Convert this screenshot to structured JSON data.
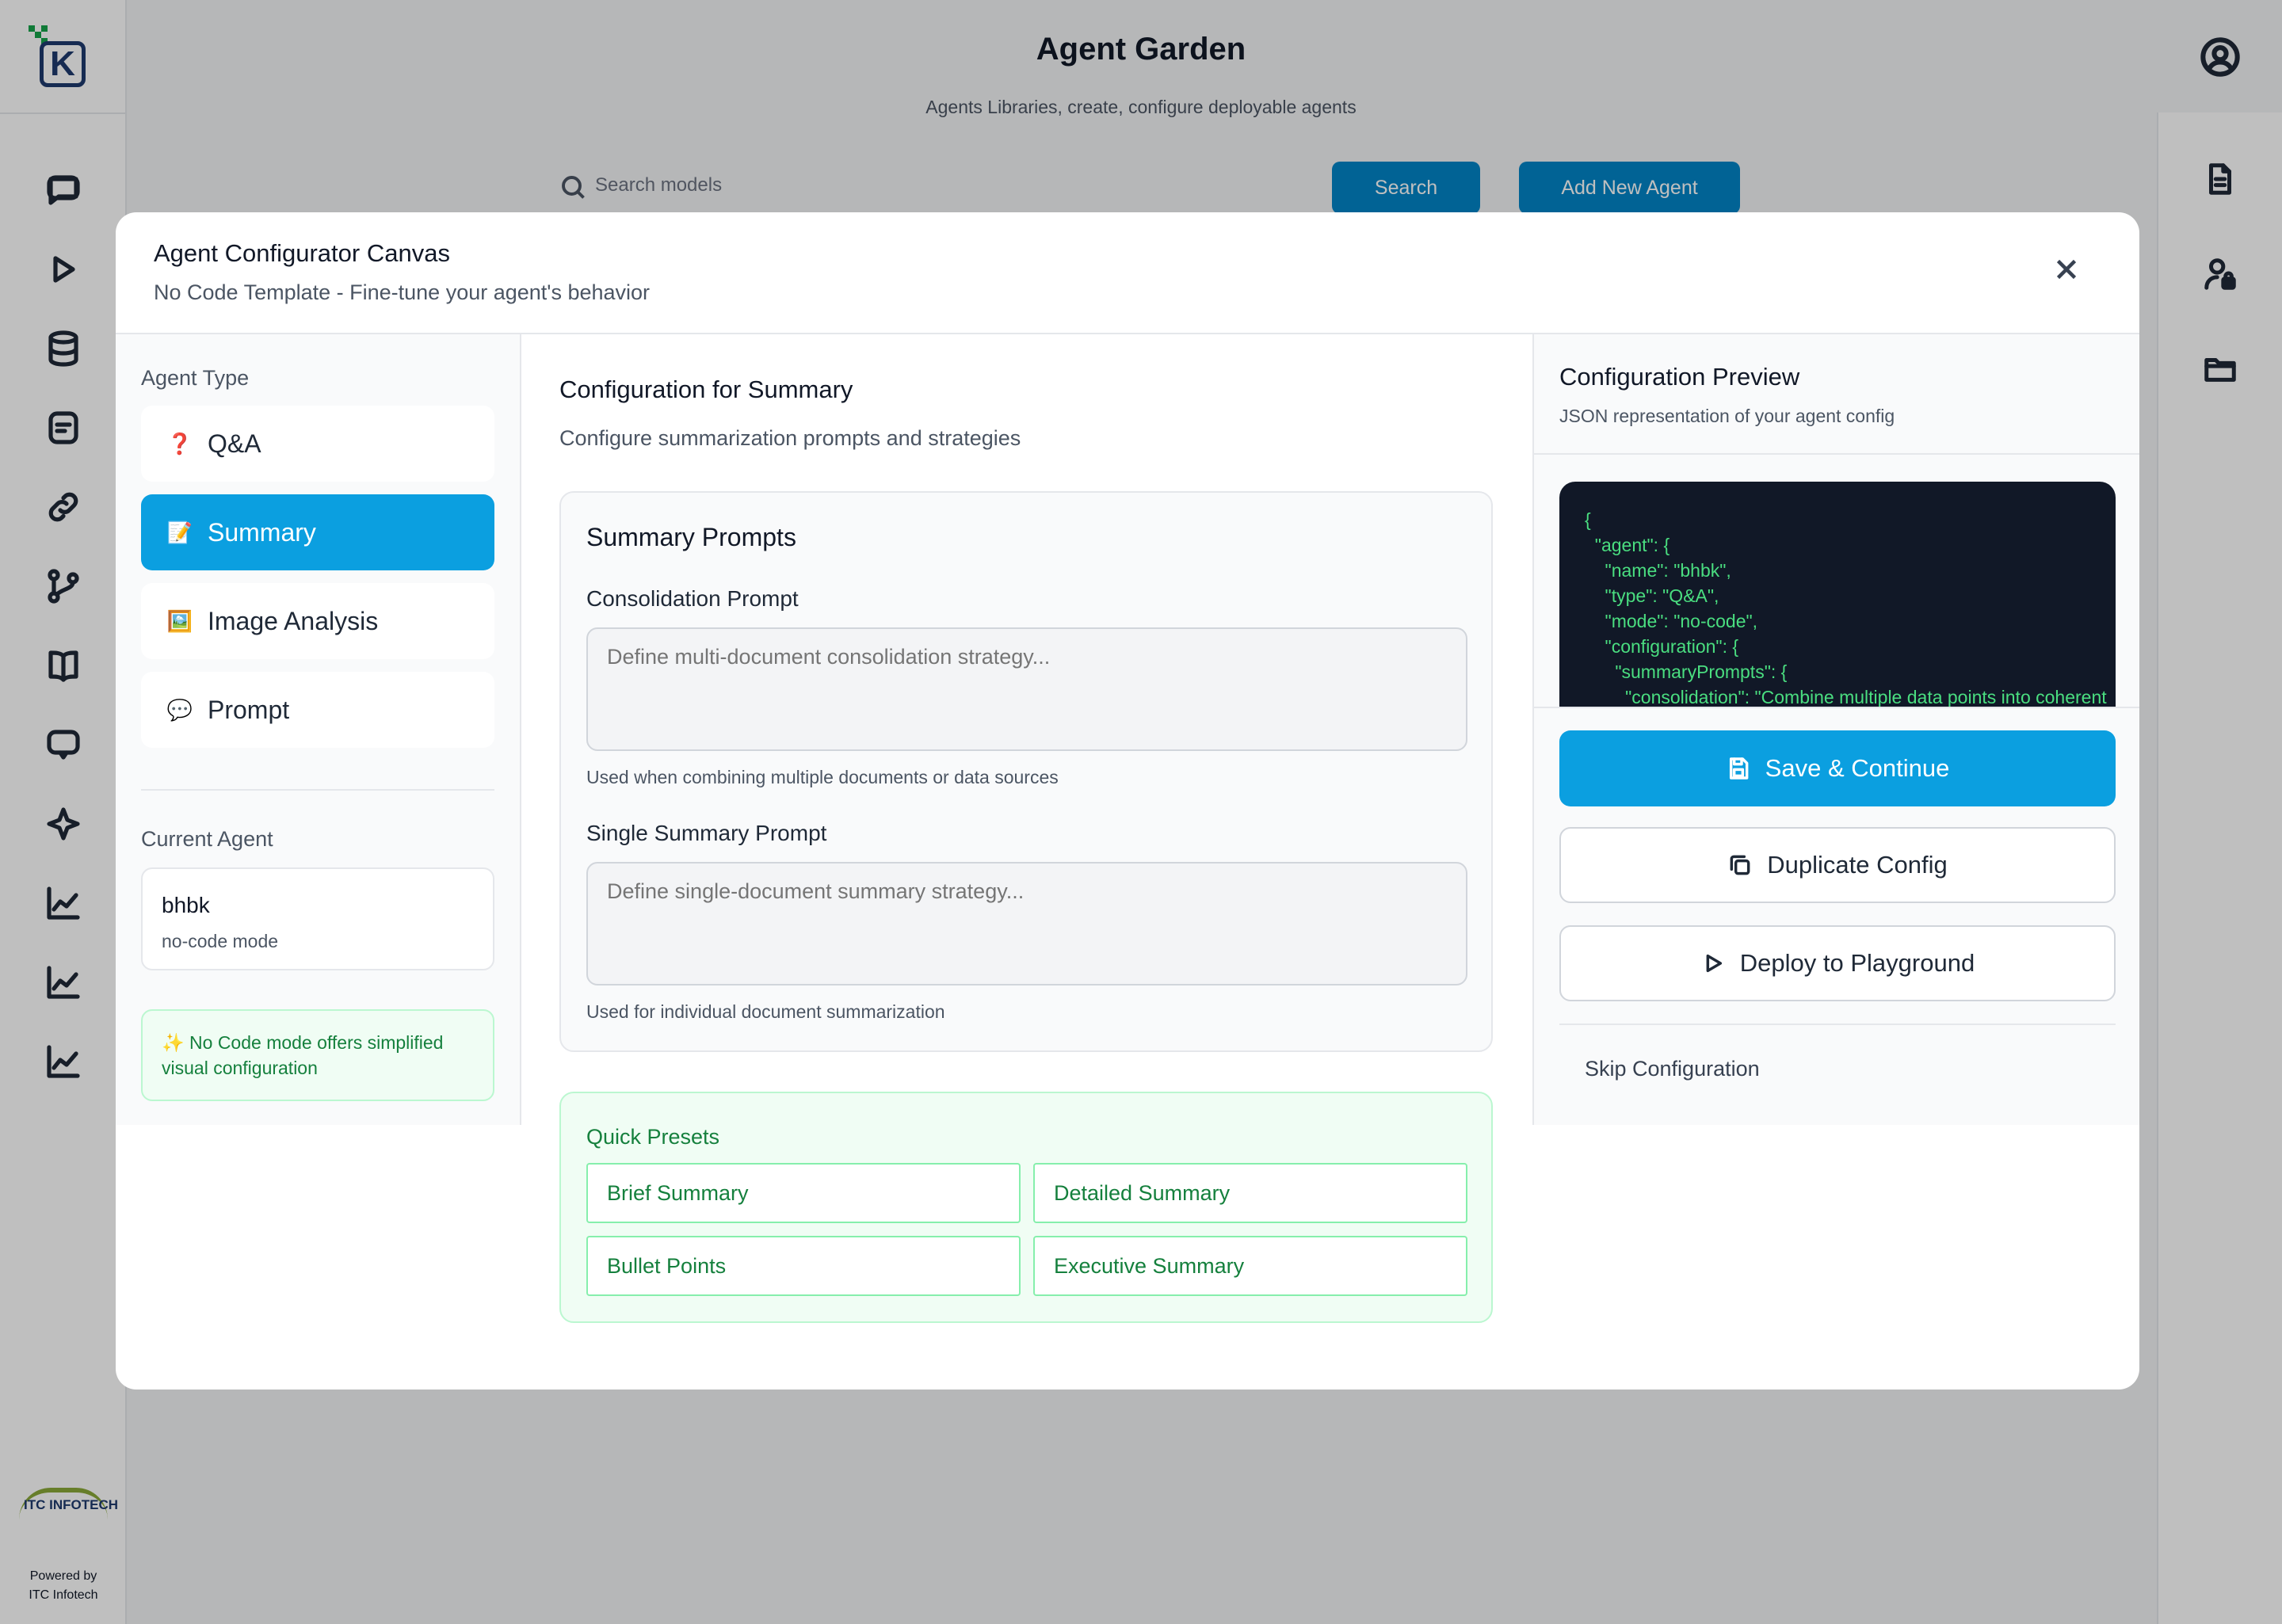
{
  "header": {
    "title": "Agent Garden",
    "subtitle": "Agents Libraries, create, configure deployable agents",
    "search_placeholder": "Search models",
    "search_button": "Search",
    "add_agent_button": "Add New Agent"
  },
  "left_rail": {
    "icons": [
      "chat-icon",
      "play-icon",
      "database-icon",
      "document-icon",
      "link-icon",
      "git-branch-icon",
      "book-icon",
      "message-icon",
      "sparkle-icon",
      "chart-icon",
      "chart-icon",
      "chart-icon"
    ],
    "powered_by": "Powered by",
    "company": "ITC Infotech",
    "logo_text": "ITC INFOTECH"
  },
  "right_rail": {
    "icons": [
      "file-icon",
      "user-lock-icon",
      "folder-icon"
    ]
  },
  "modal": {
    "title": "Agent Configurator Canvas",
    "subtitle": "No Code Template - Fine-tune your agent's behavior",
    "agent_type_label": "Agent Type",
    "agent_types": [
      {
        "emoji": "❓",
        "label": "Q&A",
        "active": false
      },
      {
        "emoji": "📝",
        "label": "Summary",
        "active": true
      },
      {
        "emoji": "🖼️",
        "label": "Image Analysis",
        "active": false
      },
      {
        "emoji": "💬",
        "label": "Prompt",
        "active": false
      }
    ],
    "current_agent_label": "Current Agent",
    "current_agent": {
      "name": "bhbk",
      "mode": "no-code mode"
    },
    "nocode_note": "✨ No Code mode offers simplified visual configuration",
    "config": {
      "title": "Configuration for Summary",
      "subtitle": "Configure summarization prompts and strategies",
      "prompts_title": "Summary Prompts",
      "consolidation_label": "Consolidation Prompt",
      "consolidation_placeholder": "Define multi-document consolidation strategy...",
      "consolidation_help": "Used when combining multiple documents or data sources",
      "single_label": "Single Summary Prompt",
      "single_placeholder": "Define single-document summary strategy...",
      "single_help": "Used for individual document summarization"
    },
    "presets": {
      "title": "Quick Presets",
      "items": [
        "Brief Summary",
        "Detailed Summary",
        "Bullet Points",
        "Executive Summary"
      ]
    },
    "preview": {
      "title": "Configuration Preview",
      "subtitle": "JSON representation of your agent config",
      "json_text": "{\n  \"agent\": {\n    \"name\": \"bhbk\",\n    \"type\": \"Q&A\",\n    \"mode\": \"no-code\",\n    \"configuration\": {\n      \"summaryPrompts\": {\n        \"consolidation\": \"Combine multiple data points into coherent"
    },
    "actions": {
      "save": "Save & Continue",
      "duplicate": "Duplicate Config",
      "deploy": "Deploy to Playground",
      "skip": "Skip Configuration"
    }
  },
  "colors": {
    "primary": "#0b9fe0",
    "brand_blue": "#0284c7",
    "success_green": "#15803d",
    "json_bg": "#111827",
    "json_text": "#4ade80"
  }
}
